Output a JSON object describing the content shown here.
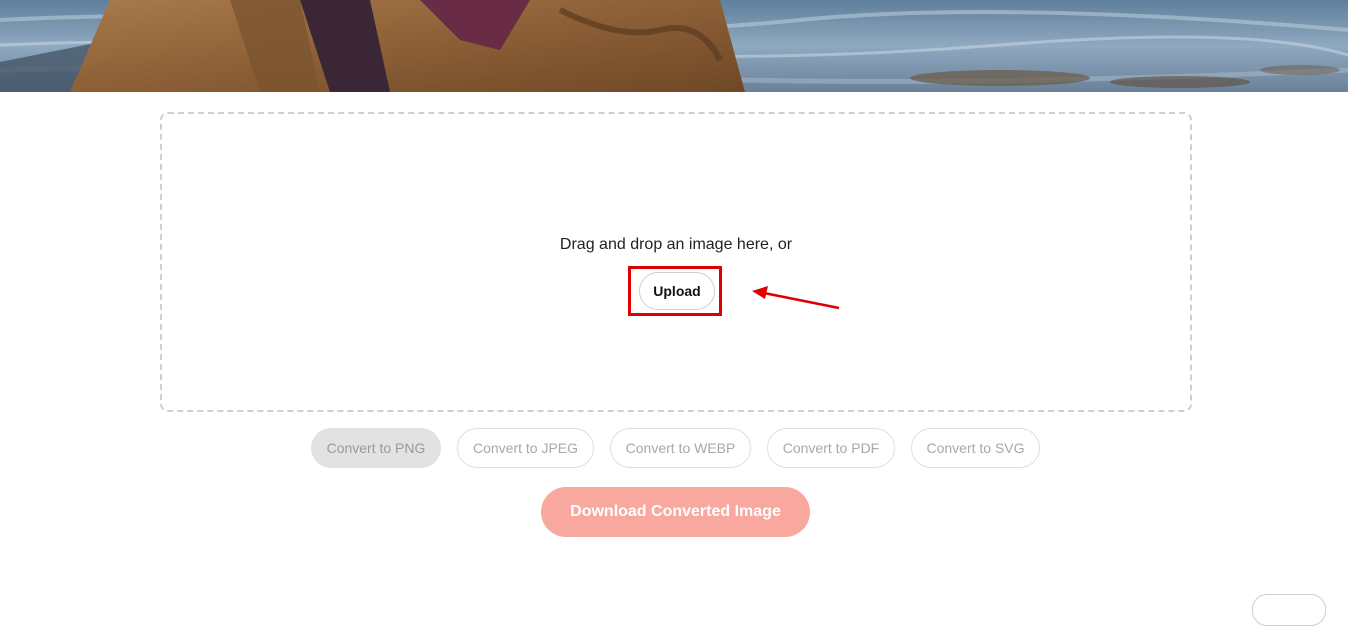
{
  "dropzone": {
    "prompt": "Drag and drop an image here, or",
    "upload_label": "Upload"
  },
  "convert_options": [
    {
      "label": "Convert to PNG",
      "selected": true
    },
    {
      "label": "Convert to JPEG",
      "selected": false
    },
    {
      "label": "Convert to WEBP",
      "selected": false
    },
    {
      "label": "Convert to PDF",
      "selected": false
    },
    {
      "label": "Convert to SVG",
      "selected": false
    }
  ],
  "download": {
    "label": "Download Converted Image"
  },
  "colors": {
    "accent_download": "#f9a8a0",
    "highlight": "#e00000",
    "selected_option": "#e2e2e2"
  }
}
